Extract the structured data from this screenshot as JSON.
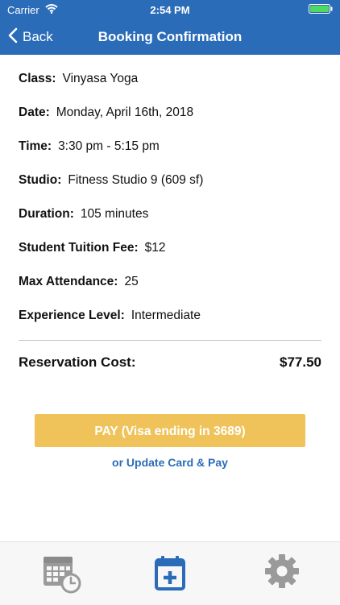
{
  "status_bar": {
    "carrier": "Carrier",
    "time": "2:54 PM"
  },
  "nav": {
    "back_label": "Back",
    "title": "Booking Confirmation"
  },
  "details": [
    {
      "label": "Class:",
      "value": "Vinyasa Yoga"
    },
    {
      "label": "Date:",
      "value": "Monday, April 16th, 2018"
    },
    {
      "label": "Time:",
      "value": "3:30 pm - 5:15 pm"
    },
    {
      "label": "Studio:",
      "value": "Fitness Studio 9 (609 sf)"
    },
    {
      "label": "Duration:",
      "value": "105 minutes"
    },
    {
      "label": "Student Tuition Fee:",
      "value": "$12"
    },
    {
      "label": "Max Attendance:",
      "value": "25"
    },
    {
      "label": "Experience Level:",
      "value": "Intermediate"
    }
  ],
  "reservation": {
    "label": "Reservation Cost:",
    "amount": "$77.50"
  },
  "pay_button_label": "PAY  (Visa ending in 3689)",
  "update_link_label": "or Update Card & Pay",
  "tabs": [
    {
      "icon": "calendar-clock-icon",
      "active": false
    },
    {
      "icon": "calendar-add-icon",
      "active": true
    },
    {
      "icon": "gear-icon",
      "active": false
    }
  ],
  "colors": {
    "accent": "#2b6cb8",
    "pay_button": "#efc35a",
    "tab_inactive": "#9a9a9a",
    "battery": "#4cd964"
  }
}
